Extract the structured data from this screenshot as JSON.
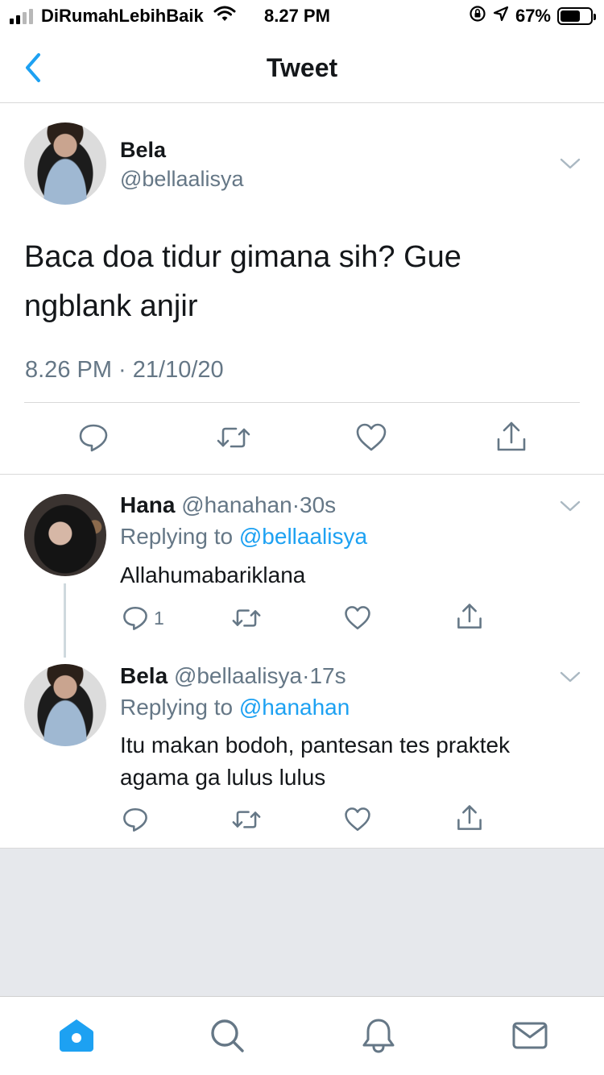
{
  "status_bar": {
    "carrier": "DiRumahLebihBaik",
    "time": "8.27 PM",
    "battery": "67%",
    "battery_level": 0.67,
    "icons": [
      "signal-icon",
      "wifi-icon",
      "orientation-lock-icon",
      "location-icon",
      "battery-icon"
    ]
  },
  "nav": {
    "title": "Tweet",
    "back_icon": "chevron-left-icon"
  },
  "main_tweet": {
    "name": "Bela",
    "handle": "@bellaalisya",
    "text": "Baca doa tidur gimana sih? Gue ngblank anjir",
    "timestamp": "8.26 PM · 21/10/20",
    "actions": [
      "reply-icon",
      "retweet-icon",
      "like-icon",
      "share-icon"
    ]
  },
  "replies": [
    {
      "name": "Hana",
      "handle": "@hanahan",
      "dot": "·",
      "ago": "30s",
      "replying_prefix": "Replying to",
      "replying_to": "@bellaalisya",
      "text": "Allahumabariklana",
      "reply_count": "1"
    },
    {
      "name": "Bela",
      "handle": "@bellaalisya",
      "dot": "·",
      "ago": "17s",
      "replying_prefix": "Replying to",
      "replying_to": "@hanahan",
      "text": "Itu makan bodoh, pantesan tes praktek agama ga lulus lulus",
      "reply_count": ""
    }
  ],
  "tab_bar": {
    "tabs": [
      "home-icon",
      "search-icon",
      "notifications-icon",
      "messages-icon"
    ],
    "active": "home-icon"
  },
  "colors": {
    "accent": "#1da1f2",
    "secondary_text": "#657786",
    "divider": "#d9d9d9",
    "background_empty": "#e6e8ec"
  }
}
